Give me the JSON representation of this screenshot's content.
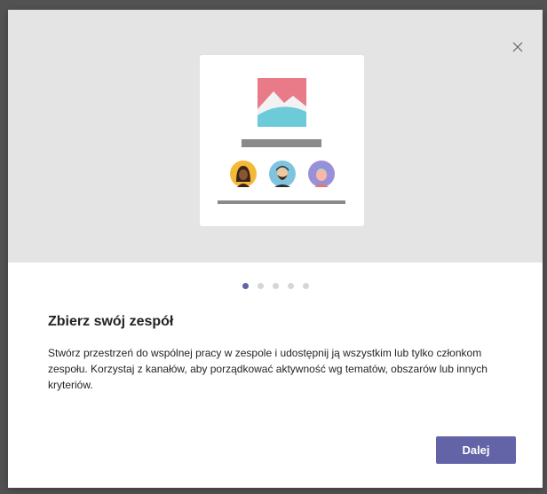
{
  "dialog": {
    "close_icon": "close-icon",
    "illustration": {
      "image_icon": "image-placeholder-icon",
      "avatars": [
        "avatar-woman",
        "avatar-bearded-man",
        "avatar-cap-person"
      ]
    },
    "pager": {
      "total": 5,
      "active_index": 0
    },
    "heading": "Zbierz swój zespół",
    "description": "Stwórz przestrzeń do wspólnej pracy w zespole i udostępnij ją wszystkim lub tylko członkom zespołu. Korzystaj z kanałów, aby porządkować aktywność wg tematów, obszarów lub innych kryteriów.",
    "next_label": "Dalej"
  },
  "colors": {
    "accent": "#6264a7",
    "hero_bg": "#e4e4e4",
    "window_bg": "#525252"
  }
}
